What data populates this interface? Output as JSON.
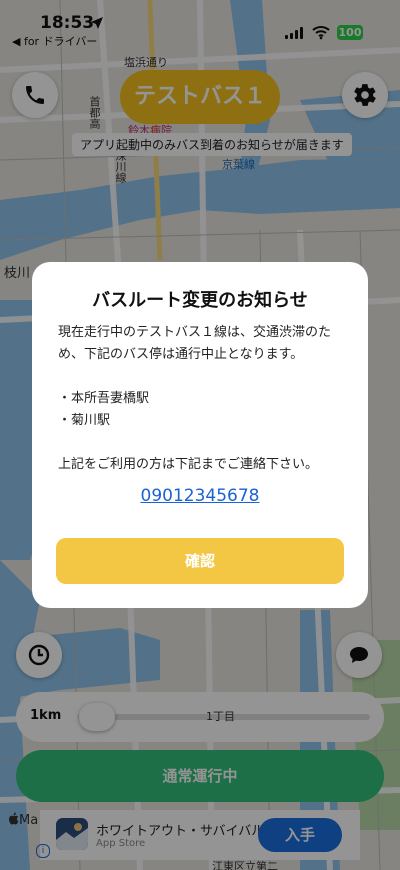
{
  "status_bar": {
    "time": "18:53",
    "back_app": "◀ for ドライバー",
    "battery": "100"
  },
  "map": {
    "labels": [
      "塩浜通り",
      "首都高",
      "鈴木病院",
      "京葉線",
      "深川線",
      "枝川",
      "1丁目",
      "江東区立第二"
    ]
  },
  "top_bar": {
    "bus_name": "テストバス１",
    "arrival_notice": "アプリ起動中のみバス到着のお知らせが届きます"
  },
  "modal": {
    "title": "バスルート変更のお知らせ",
    "body_line1": "現在走行中のテストバス１線は、交通渋滞のため、下記のバス停は通行中止となります。",
    "stops": [
      "・本所吾妻橋駅",
      "・菊川駅"
    ],
    "contact_line": "上記をご利用の方は下記までご連絡下さい。",
    "phone": "09012345678",
    "confirm_label": "確認"
  },
  "slider": {
    "distance_label": "1km",
    "distance_fraction": 0.05
  },
  "status_button": {
    "label": "通常運行中"
  },
  "ad": {
    "title": "ホワイトアウト・サバイバル",
    "store": "App Store",
    "cta": "入手",
    "info_glyph": "i"
  },
  "maps_logo": "Ma",
  "colors": {
    "bus_pill": "#f4c21f",
    "confirm": "#f3c744",
    "status_green": "#32c07a",
    "link_blue": "#1a62d6",
    "cta_blue": "#1a6fe0",
    "battery_green": "#2bd24a"
  },
  "icons": {
    "phone": "phone-icon",
    "settings": "gear-icon",
    "history": "clock-icon",
    "chat": "chat-bubble-icon",
    "location": "location-arrow-icon"
  }
}
